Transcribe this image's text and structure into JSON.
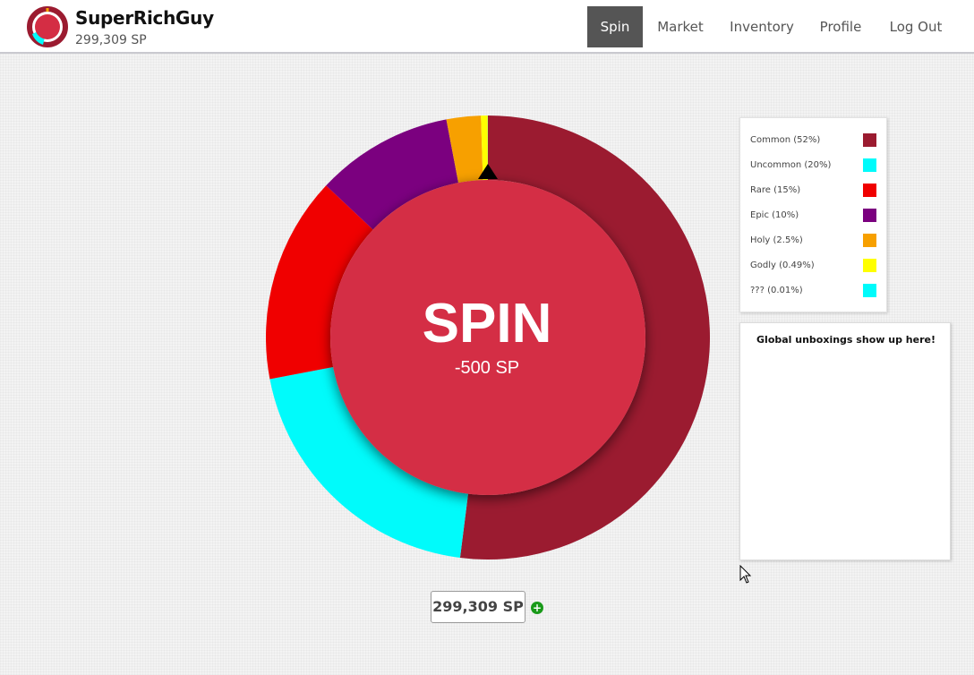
{
  "header": {
    "username": "SuperRichGuy",
    "balance": "299,309 SP"
  },
  "nav": {
    "spin": "Spin",
    "market": "Market",
    "inventory": "Inventory",
    "profile": "Profile",
    "logout": "Log Out"
  },
  "wheel": {
    "spin_label": "SPIN",
    "cost": "-500 SP",
    "segments": [
      {
        "name": "Common",
        "fraction": 0.52,
        "color": "#9b1b30"
      },
      {
        "name": "Uncommon",
        "fraction": 0.2,
        "color": "#00fbfb"
      },
      {
        "name": "Rare",
        "fraction": 0.15,
        "color": "#f00000"
      },
      {
        "name": "Epic",
        "fraction": 0.1,
        "color": "#7b007f"
      },
      {
        "name": "Holy",
        "fraction": 0.025,
        "color": "#f7a000"
      },
      {
        "name": "Godly",
        "fraction": 0.0049,
        "color": "#ffff00"
      },
      {
        "name": "???",
        "fraction": 0.0001,
        "color": "#00fbfb"
      }
    ],
    "center_color": "#d42d44"
  },
  "legend": {
    "items": [
      {
        "label": "Common (52%)",
        "color": "#9b1b30"
      },
      {
        "label": "Uncommon (20%)",
        "color": "#00fbfb"
      },
      {
        "label": "Rare (15%)",
        "color": "#f00000"
      },
      {
        "label": "Epic (10%)",
        "color": "#7b007f"
      },
      {
        "label": "Holy (2.5%)",
        "color": "#f7a000"
      },
      {
        "label": "Godly (0.49%)",
        "color": "#ffff00"
      },
      {
        "label": "??? (0.01%)",
        "color": "#00fbfb"
      }
    ]
  },
  "feed": {
    "title": "Global unboxings show up here!"
  },
  "footer": {
    "balance": "299,309 SP",
    "add_icon": "plus-circle-icon"
  }
}
